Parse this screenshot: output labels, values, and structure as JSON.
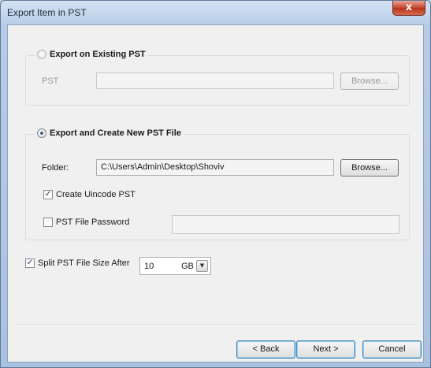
{
  "window": {
    "title": "Export Item in PST",
    "close_glyph": "x"
  },
  "existing": {
    "legend": "Export on Existing PST",
    "pst_label": "PST",
    "pst_value": "",
    "browse_label": "Browse..."
  },
  "create_new": {
    "legend": "Export and Create New PST File",
    "folder_label": "Folder:",
    "folder_value": "C:\\Users\\Admin\\Desktop\\Shoviv",
    "browse_label": "Browse...",
    "unicode_label": "Create Uincode PST",
    "unicode_checked": true,
    "password_label": "PST File Password",
    "password_checked": false,
    "password_value": ""
  },
  "split": {
    "label": "Split PST File Size After",
    "checked": true,
    "size_value": "10",
    "unit": "GB"
  },
  "footer": {
    "back_label": "< Back",
    "next_label": "Next >",
    "cancel_label": "Cancel"
  }
}
